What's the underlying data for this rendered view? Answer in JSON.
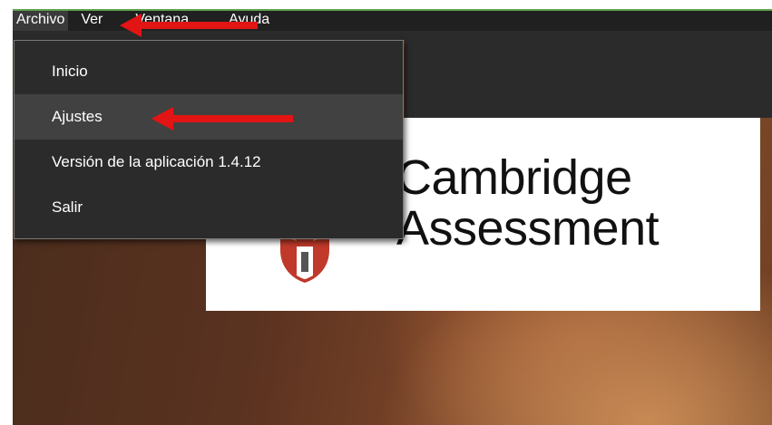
{
  "menubar": {
    "items": [
      {
        "label": "Archivo"
      },
      {
        "label": "Ver"
      },
      {
        "label": "Ventana"
      },
      {
        "label": "Ayuda"
      }
    ]
  },
  "dropdown": {
    "items": [
      {
        "label": "Inicio"
      },
      {
        "label": "Ajustes"
      },
      {
        "label": "Versión de la aplicación 1.4.12"
      },
      {
        "label": "Salir"
      }
    ]
  },
  "logo": {
    "line1": "Cambridge",
    "line2": "Assessment",
    "icon": "university-shield-icon"
  },
  "colors": {
    "menubar_bg": "#202020",
    "menu_bg": "#2b2b2b",
    "menu_hover": "#414141",
    "annotation_arrow": "#e31414",
    "shield_red": "#c0392b"
  }
}
